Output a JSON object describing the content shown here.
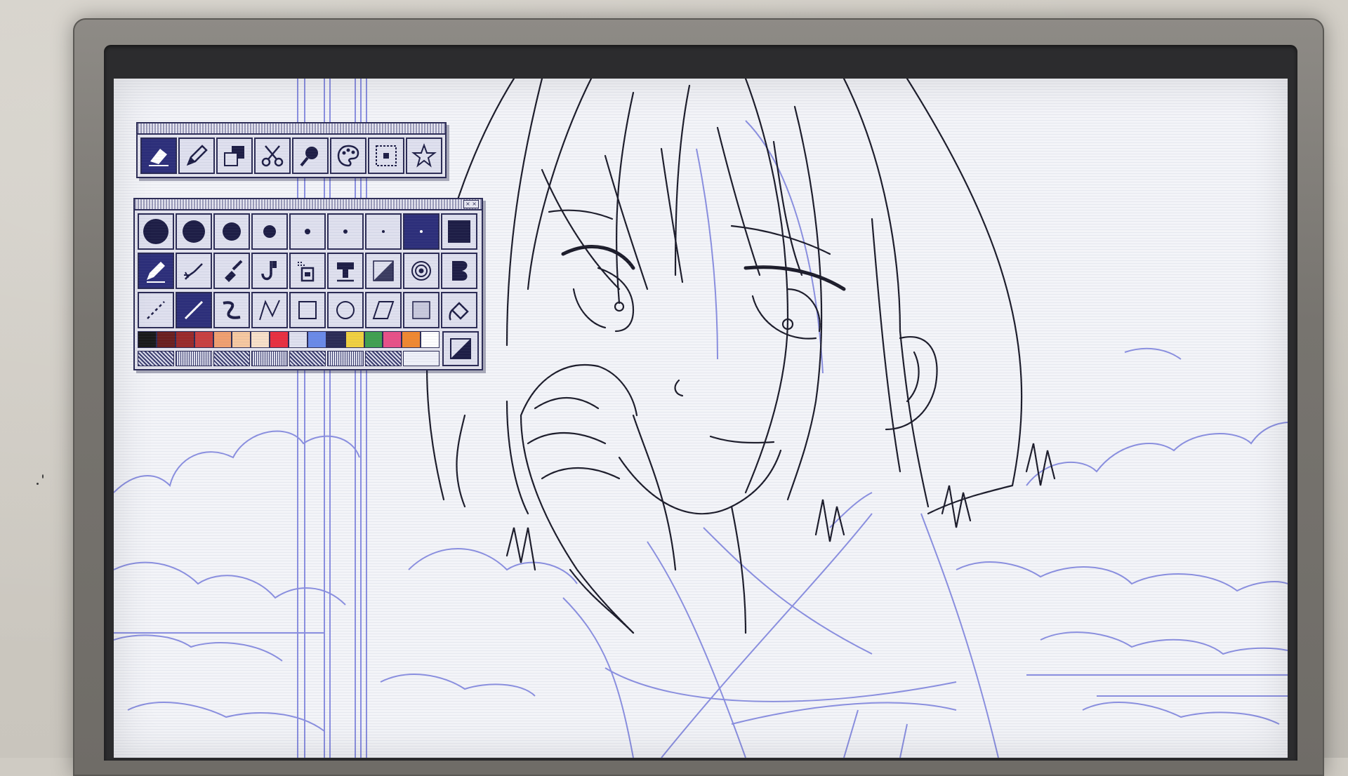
{
  "app": {
    "accent_color": "#2d2f7a",
    "line_color": "#1c1c2a",
    "sketch_color": "#8a8fe0"
  },
  "toolbar": {
    "tools": [
      {
        "name": "eraser-icon",
        "selected": true
      },
      {
        "name": "pen-icon",
        "selected": false
      },
      {
        "name": "layer-copy-icon",
        "selected": false
      },
      {
        "name": "scissors-icon",
        "selected": false
      },
      {
        "name": "magnifier-icon",
        "selected": false
      },
      {
        "name": "palette-icon",
        "selected": false
      },
      {
        "name": "select-frame-icon",
        "selected": false
      },
      {
        "name": "star-icon",
        "selected": false
      }
    ]
  },
  "brush_panel": {
    "brush_sizes": [
      "size-1",
      "size-2",
      "size-3",
      "size-4",
      "size-5",
      "size-6",
      "size-7",
      "size-8",
      "size-fill"
    ],
    "selected_brush_size": 7,
    "brush_tools": [
      {
        "name": "pencil-icon",
        "selected": true
      },
      {
        "name": "airbrush-icon",
        "selected": false
      },
      {
        "name": "brush-icon",
        "selected": false
      },
      {
        "name": "smudge-icon",
        "selected": false
      },
      {
        "name": "stamp-icon",
        "selected": false
      },
      {
        "name": "fill-stamp-icon",
        "selected": false
      },
      {
        "name": "gradient-icon",
        "selected": false
      },
      {
        "name": "target-icon",
        "selected": false
      },
      {
        "name": "bucket-b-icon",
        "selected": false
      }
    ],
    "shape_tools": [
      {
        "name": "dotted-line-icon",
        "selected": false
      },
      {
        "name": "line-icon",
        "selected": true
      },
      {
        "name": "freehand-icon",
        "selected": false
      },
      {
        "name": "polyline-icon",
        "selected": false
      },
      {
        "name": "rectangle-icon",
        "selected": false
      },
      {
        "name": "ellipse-icon",
        "selected": false
      },
      {
        "name": "parallelogram-icon",
        "selected": false
      },
      {
        "name": "filled-rect-icon",
        "selected": false
      },
      {
        "name": "paint-bucket-icon",
        "selected": false
      }
    ],
    "colors": [
      "#1a1a1a",
      "#6b1f1f",
      "#9a2a2a",
      "#c84040",
      "#f0a070",
      "#f6c8a0",
      "#f8e0c8",
      "#e83040",
      "#dfe0ee",
      "#6a8ae8",
      "#2b2b55",
      "#f0d040",
      "#40a050",
      "#e85088",
      "#f08830",
      "#ffffff"
    ],
    "patterns": 7
  }
}
